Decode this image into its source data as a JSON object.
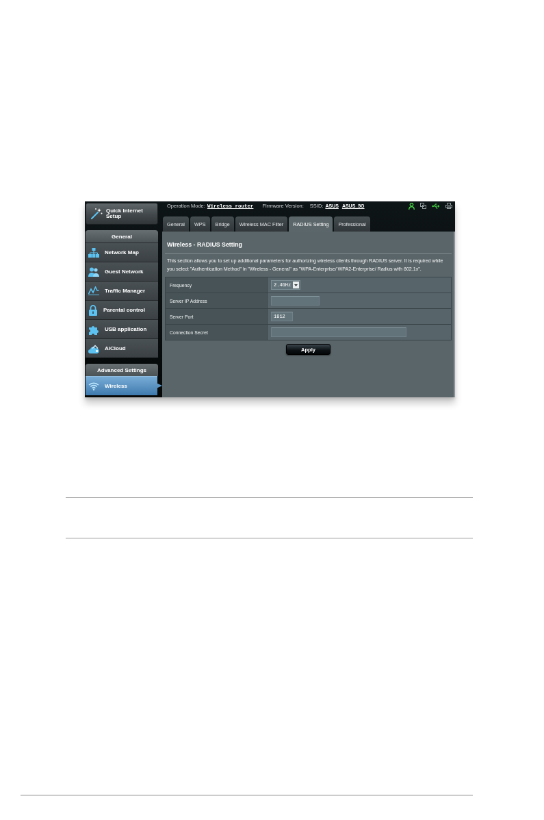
{
  "header": {
    "operation_mode_label": "Operation Mode:",
    "operation_mode": "Wireless router",
    "firmware_label": "Firmware Version:",
    "ssid_label": "SSID:",
    "ssids": [
      "ASUS",
      "ASUS_5G"
    ],
    "status_icons": [
      {
        "kind": "user",
        "on": true
      },
      {
        "kind": "windows",
        "on": false
      },
      {
        "kind": "usb",
        "on": true
      },
      {
        "kind": "printer",
        "on": false
      }
    ]
  },
  "sidebar": {
    "quick_setup": "Quick Internet Setup",
    "sections": [
      {
        "title": "General",
        "items": [
          {
            "label": "Network Map",
            "kind": "network",
            "selected": false
          },
          {
            "label": "Guest Network",
            "kind": "guests",
            "selected": false
          },
          {
            "label": "Traffic Manager",
            "kind": "traffic",
            "selected": false
          },
          {
            "label": "Parental control",
            "kind": "lock",
            "selected": false
          },
          {
            "label": "USB application",
            "kind": "puzzle",
            "selected": false
          },
          {
            "label": "AiCloud",
            "kind": "cloud",
            "selected": false
          }
        ]
      },
      {
        "title": "Advanced Settings",
        "items": [
          {
            "label": "Wireless",
            "kind": "wifi",
            "selected": true
          }
        ]
      }
    ]
  },
  "tabs": [
    {
      "label": "General",
      "selected": false
    },
    {
      "label": "WPS",
      "selected": false
    },
    {
      "label": "Bridge",
      "selected": false
    },
    {
      "label": "Wireless MAC Filter",
      "selected": false
    },
    {
      "label": "RADIUS Setting",
      "selected": true
    },
    {
      "label": "Professional",
      "selected": false
    }
  ],
  "panel": {
    "title": "Wireless - RADIUS Setting",
    "description": "This section allows you to set up additional parameters for authorizing wireless clients through RADIUS server. It is required while you select \"Authentication Method\" in \"Wireless - General\" as \"WPA-Enterprise/ WPA2-Enterprise/ Radius with 802.1x\".",
    "fields": [
      {
        "label": "Frequency",
        "kind": "select",
        "value": "2.4GHz"
      },
      {
        "label": "Server IP Address",
        "kind": "address"
      },
      {
        "label": "Server Port",
        "kind": "port",
        "value": "1812"
      },
      {
        "label": "Connection Secret",
        "kind": "secret"
      }
    ],
    "apply": "Apply"
  }
}
